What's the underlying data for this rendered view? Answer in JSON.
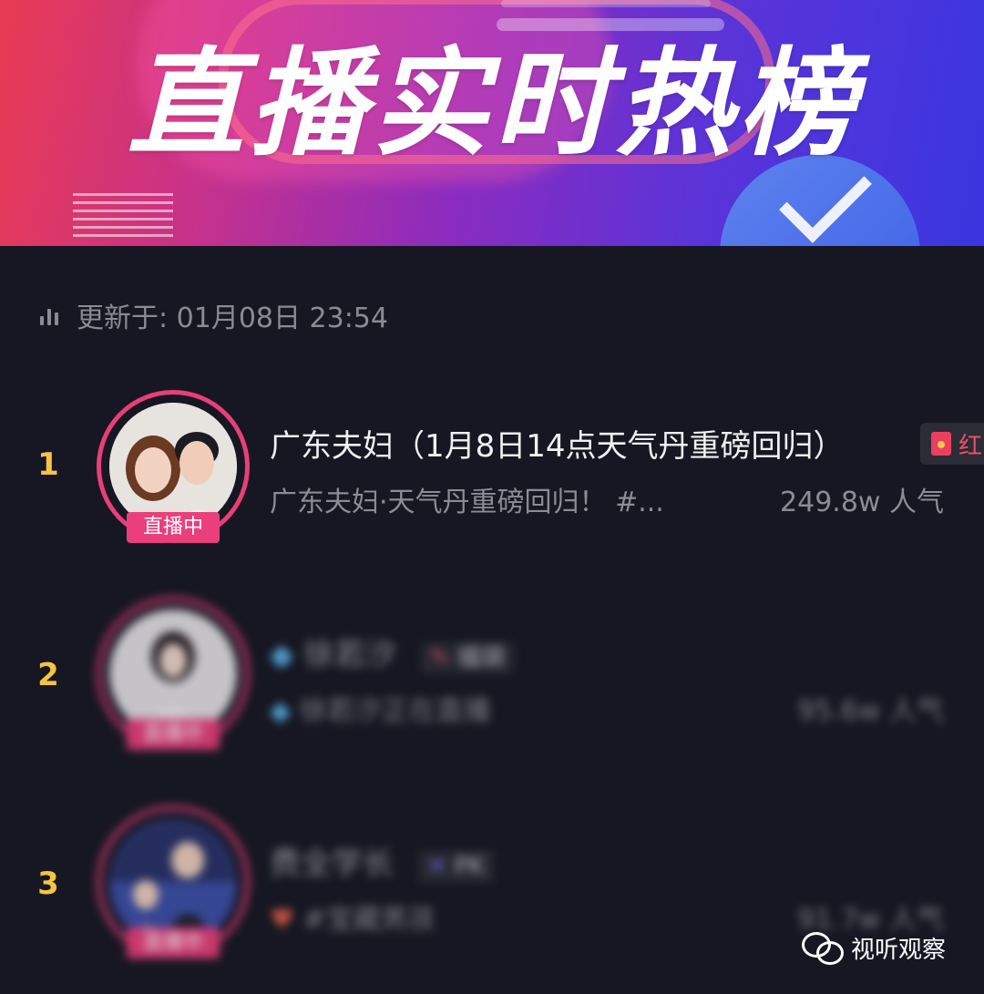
{
  "banner": {
    "title": "直播实时热榜"
  },
  "update": {
    "label": "更新于: 01月08日 23:54"
  },
  "rows": [
    {
      "rank": "1",
      "name": "广东夫妇（1月8日14点天气丹重磅回归）",
      "subtitle": "广东夫妇·天气丹重磅回归！ #...",
      "heat": "249.8w 人气",
      "live_badge": "直播中",
      "tag": "红",
      "blurred": false
    },
    {
      "rank": "2",
      "name": "徐若汐",
      "subtitle": "徐若汐正在直播",
      "heat": "95.6w 人气",
      "live_badge": "直播中",
      "tag": "福袋",
      "blurred": true
    },
    {
      "rank": "3",
      "name": "费全学长",
      "subtitle": "#宝藏男孩",
      "heat": "91.7w 人气",
      "live_badge": "直播中",
      "tag": "PK",
      "blurred": true
    }
  ],
  "watermark": {
    "text": "视听观察"
  },
  "colors": {
    "rank": "#f4c443",
    "live_badge": "#ea3f7c",
    "background": "#161722"
  }
}
